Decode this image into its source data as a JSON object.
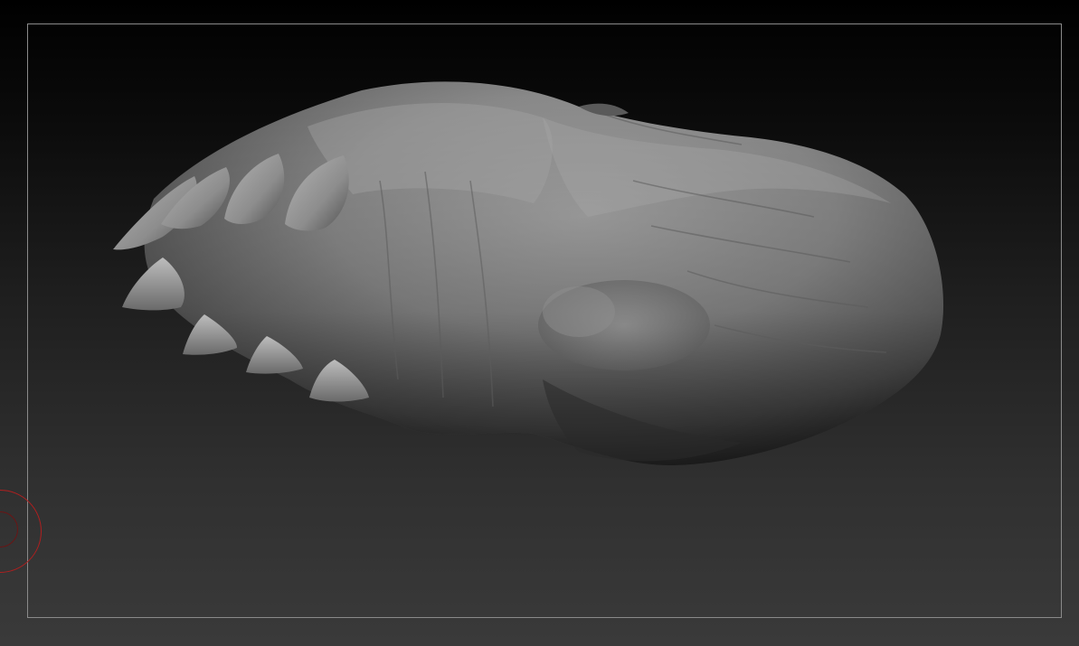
{
  "viewport": {
    "background_top": "#000000",
    "background_bottom": "#3a3a3a",
    "frame_color": "#8a8a8a",
    "model_color": "#8c8c8c"
  },
  "brush_cursor": {
    "color": "#b01f1f"
  },
  "icons": {
    "brush": "brush-cursor-icon"
  }
}
